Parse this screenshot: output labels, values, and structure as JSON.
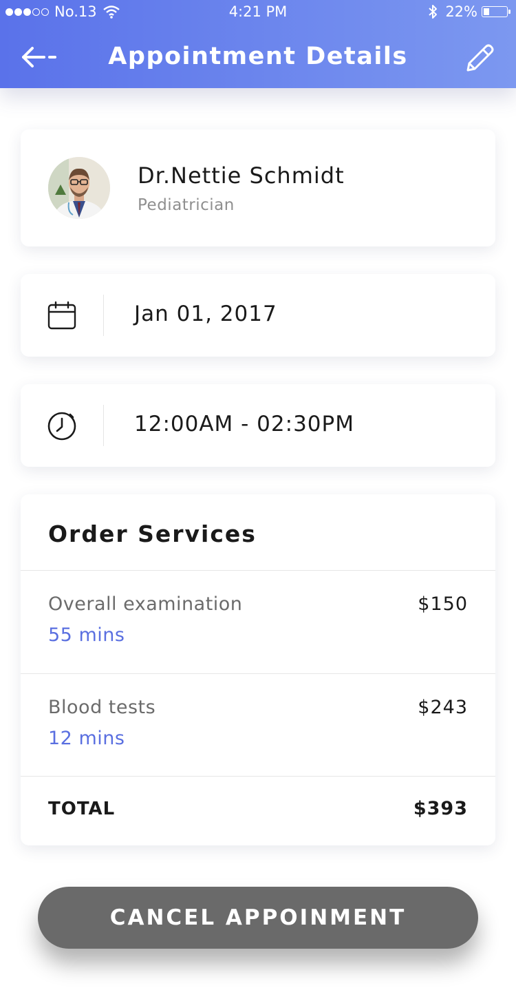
{
  "status_bar": {
    "carrier": "No.13",
    "time": "4:21 PM",
    "battery": "22%",
    "battery_level": 0.22,
    "signal_bars_filled": 3,
    "signal_bars_total": 5
  },
  "header": {
    "title": "Appointment Details",
    "back_icon": "arrow-left-icon",
    "edit_icon": "pencil-icon",
    "gradient_start": "#5a72ea",
    "gradient_end": "#7c98f0"
  },
  "doctor": {
    "name": "Dr.Nettie Schmidt",
    "specialty": "Pediatrician",
    "avatar_icon": "doctor-avatar"
  },
  "appointment": {
    "date": "Jan 01, 2017",
    "date_icon": "calendar-icon",
    "time": "12:00AM - 02:30PM",
    "time_icon": "clock-icon"
  },
  "services": {
    "title": "Order Services",
    "items": [
      {
        "name": "Overall examination",
        "duration": "55 mins",
        "price": "$150"
      },
      {
        "name": "Blood tests",
        "duration": "12 mins",
        "price": "$243"
      }
    ],
    "total_label": "TOTAL",
    "total_value": "$393",
    "accent_color": "#5a6fe0"
  },
  "actions": {
    "cancel_label": "CANCEL APPOINMENT",
    "cancel_color": "#6a6a6a"
  }
}
